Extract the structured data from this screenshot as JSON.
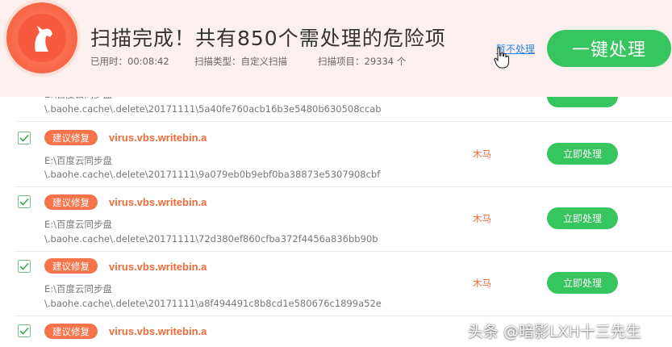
{
  "header": {
    "title": "扫描完成！共有850个需处理的危险项",
    "elapsed": "已用时：00:08:42",
    "scan_type": "扫描类型：自定义扫描",
    "scan_items": "扫描项目：29334 个",
    "skip_label": "暂不处理",
    "onekey_label": "一键处理"
  },
  "colors": {
    "accent_green": "#36c55f",
    "danger_orange": "#f06a3a",
    "header_bg": "#fbf0ef"
  },
  "partial_row": {
    "path_line1": "E:\\百度云同步盘",
    "path_line2": "\\.baohe.cache\\.delete\\20171111\\5a40fe760acb16b3e5480b630508ccab"
  },
  "rows": [
    {
      "tag": "建议修复",
      "name": "virus.vbs.writebin.a",
      "path_line1": "E:\\百度云同步盘",
      "path_line2": "\\.baohe.cache\\.delete\\20171111\\9a079eb0b9ebf0ba38873e5307908cbf",
      "type": "木马",
      "action": "立即处理"
    },
    {
      "tag": "建议修复",
      "name": "virus.vbs.writebin.a",
      "path_line1": "E:\\百度云同步盘",
      "path_line2": "\\.baohe.cache\\.delete\\20171111\\72d380ef860cfba372f4456a836bb90b",
      "type": "木马",
      "action": "立即处理"
    },
    {
      "tag": "建议修复",
      "name": "virus.vbs.writebin.a",
      "path_line1": "E:\\百度云同步盘",
      "path_line2": "\\.baohe.cache\\.delete\\20171111\\a8f494491c8b8cd1e580676c1899a52e",
      "type": "木马",
      "action": "立即处理"
    },
    {
      "tag": "建议修复",
      "name": "virus.vbs.writebin.a"
    }
  ],
  "watermark": "头条 @暗影LXH十三先生"
}
